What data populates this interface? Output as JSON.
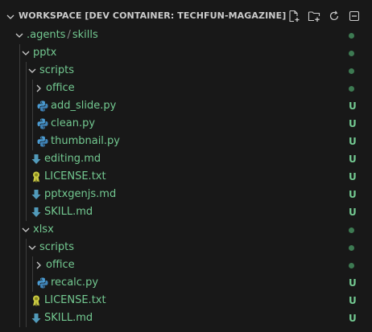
{
  "header": {
    "title": "WORKSPACE [DEV CONTAINER: TECHFUN-MAGAZINE]",
    "actions": [
      "new-file-icon",
      "new-folder-icon",
      "refresh-icon",
      "collapse-all-icon"
    ]
  },
  "colors": {
    "background": "#181818",
    "untracked": "#73c991",
    "python_icon": "#4b9cd3",
    "markdown_icon": "#519aba",
    "license_icon": "#cbcb41"
  },
  "tree": [
    {
      "label_a": ".agents",
      "label_b": "skills",
      "type": "folder",
      "open": true,
      "depth": 0,
      "status": "dot"
    },
    {
      "label": "pptx",
      "type": "folder",
      "open": true,
      "depth": 1,
      "status": "dot"
    },
    {
      "label": "scripts",
      "type": "folder",
      "open": true,
      "depth": 2,
      "status": "dot"
    },
    {
      "label": "office",
      "type": "folder",
      "open": false,
      "depth": 3,
      "status": "dot"
    },
    {
      "label": "add_slide.py",
      "type": "python",
      "depth": 3,
      "status": "U"
    },
    {
      "label": "clean.py",
      "type": "python",
      "depth": 3,
      "status": "U"
    },
    {
      "label": "thumbnail.py",
      "type": "python",
      "depth": 3,
      "status": "U"
    },
    {
      "label": "editing.md",
      "type": "markdown",
      "depth": 2,
      "status": "U"
    },
    {
      "label": "LICENSE.txt",
      "type": "license",
      "depth": 2,
      "status": "U"
    },
    {
      "label": "pptxgenjs.md",
      "type": "markdown",
      "depth": 2,
      "status": "U"
    },
    {
      "label": "SKILL.md",
      "type": "markdown",
      "depth": 2,
      "status": "U"
    },
    {
      "label": "xlsx",
      "type": "folder",
      "open": true,
      "depth": 1,
      "status": "dot"
    },
    {
      "label": "scripts",
      "type": "folder",
      "open": true,
      "depth": 2,
      "status": "dot"
    },
    {
      "label": "office",
      "type": "folder",
      "open": false,
      "depth": 3,
      "status": "dot"
    },
    {
      "label": "recalc.py",
      "type": "python",
      "depth": 3,
      "status": "U"
    },
    {
      "label": "LICENSE.txt",
      "type": "license",
      "depth": 2,
      "status": "U"
    },
    {
      "label": "SKILL.md",
      "type": "markdown",
      "depth": 2,
      "status": "U"
    }
  ]
}
